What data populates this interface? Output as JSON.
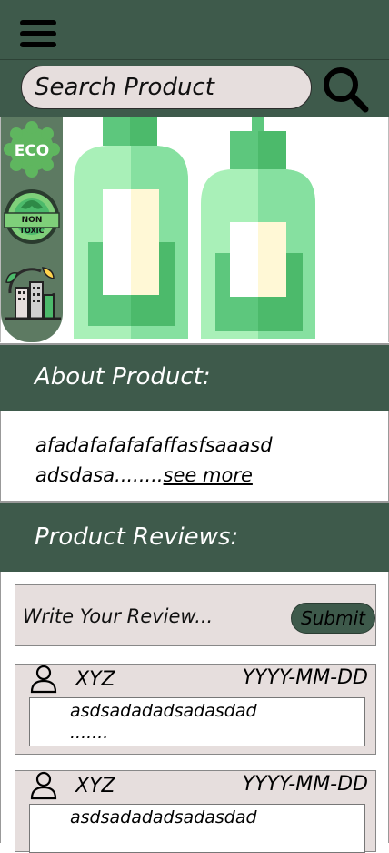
{
  "header": {
    "menu_icon": "hamburger-menu-icon"
  },
  "search": {
    "placeholder": "Search Product",
    "icon": "search-icon"
  },
  "badges": [
    {
      "name": "eco-badge-icon",
      "label": "ECO"
    },
    {
      "name": "non-toxic-badge-icon",
      "label_line1": "NON",
      "label_line2": "TOXIC"
    },
    {
      "name": "sustainable-city-icon"
    }
  ],
  "about": {
    "title": "About Product:",
    "text_line1": "afadafafafafaffasfsaaasd",
    "text_line2": "adsdasa........",
    "see_more": "see more"
  },
  "reviews": {
    "title": "Product Reviews:",
    "write_placeholder": "Write Your Review...",
    "submit_label": "Submit",
    "items": [
      {
        "name": "XYZ",
        "date": "YYYY-MM-DD",
        "text_line1": "asdsadadadsadasdad",
        "text_line2": "......."
      },
      {
        "name": "XYZ",
        "date": "YYYY-MM-DD",
        "text_line1": "asdsadadadsadasdad",
        "text_line2": ""
      }
    ]
  },
  "colors": {
    "header_green": "#3e5a4b",
    "card_bg": "#e6dedd",
    "eco_green": "#5fb65f",
    "bottle_light": "#a9f0b8",
    "bottle_mid": "#86e0a0",
    "bottle_dark": "#4cba6b"
  }
}
